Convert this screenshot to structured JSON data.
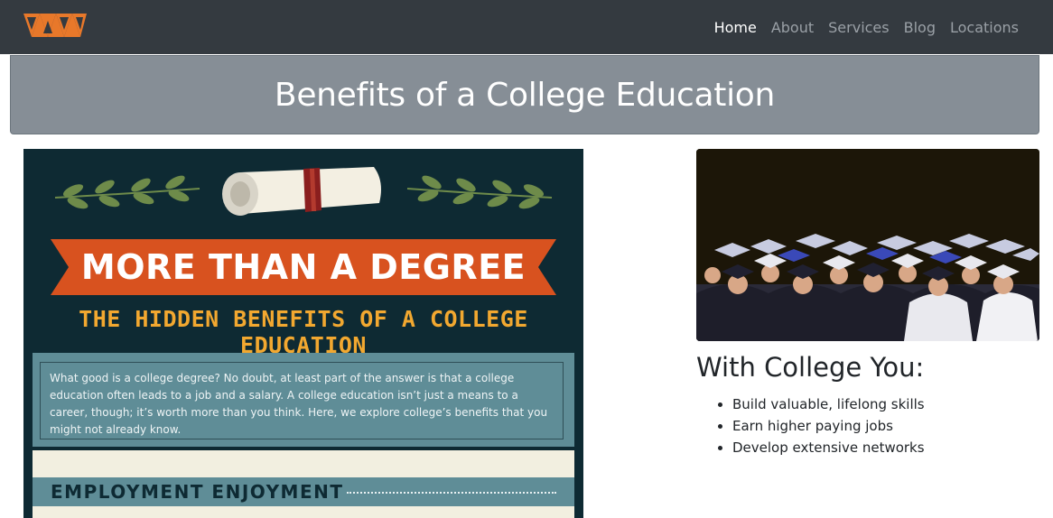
{
  "nav": {
    "logo_icon": "brand-logo-icon",
    "links": [
      {
        "label": "Home",
        "active": true
      },
      {
        "label": "About",
        "active": false
      },
      {
        "label": "Services",
        "active": false
      },
      {
        "label": "Blog",
        "active": false
      },
      {
        "label": "Locations",
        "active": false
      }
    ]
  },
  "banner": {
    "title": "Benefits of a College Education"
  },
  "infographic": {
    "title": "MORE THAN A DEGREE",
    "subtitle": "THE HIDDEN BENEFITS OF A COLLEGE EDUCATION",
    "intro": "What good is a college degree? No doubt, at least part of the answer is that a college education often leads to a job and a salary. A college education isn’t just a means to a career, though; it’s worth more than you think. Here, we explore college’s benefits that you might not already know.",
    "section_title": "EMPLOYMENT ENJOYMENT",
    "icons": [
      "laurel-branch-icon",
      "diploma-scroll-icon"
    ]
  },
  "photo": {
    "subject": "graduation-crowd-photo"
  },
  "sidebar": {
    "heading": "With College You:",
    "benefits": [
      "Build valuable, lifelong skills",
      "Earn higher paying jobs",
      "Develop extensive networks"
    ]
  },
  "colors": {
    "navbar": "#343a40",
    "banner": "#868e96",
    "infographic_bg": "#0e2a33",
    "ribbon": "#d8521f",
    "subtitle": "#f2a830",
    "panel": "#5f8d97",
    "cream": "#f2efe0"
  }
}
